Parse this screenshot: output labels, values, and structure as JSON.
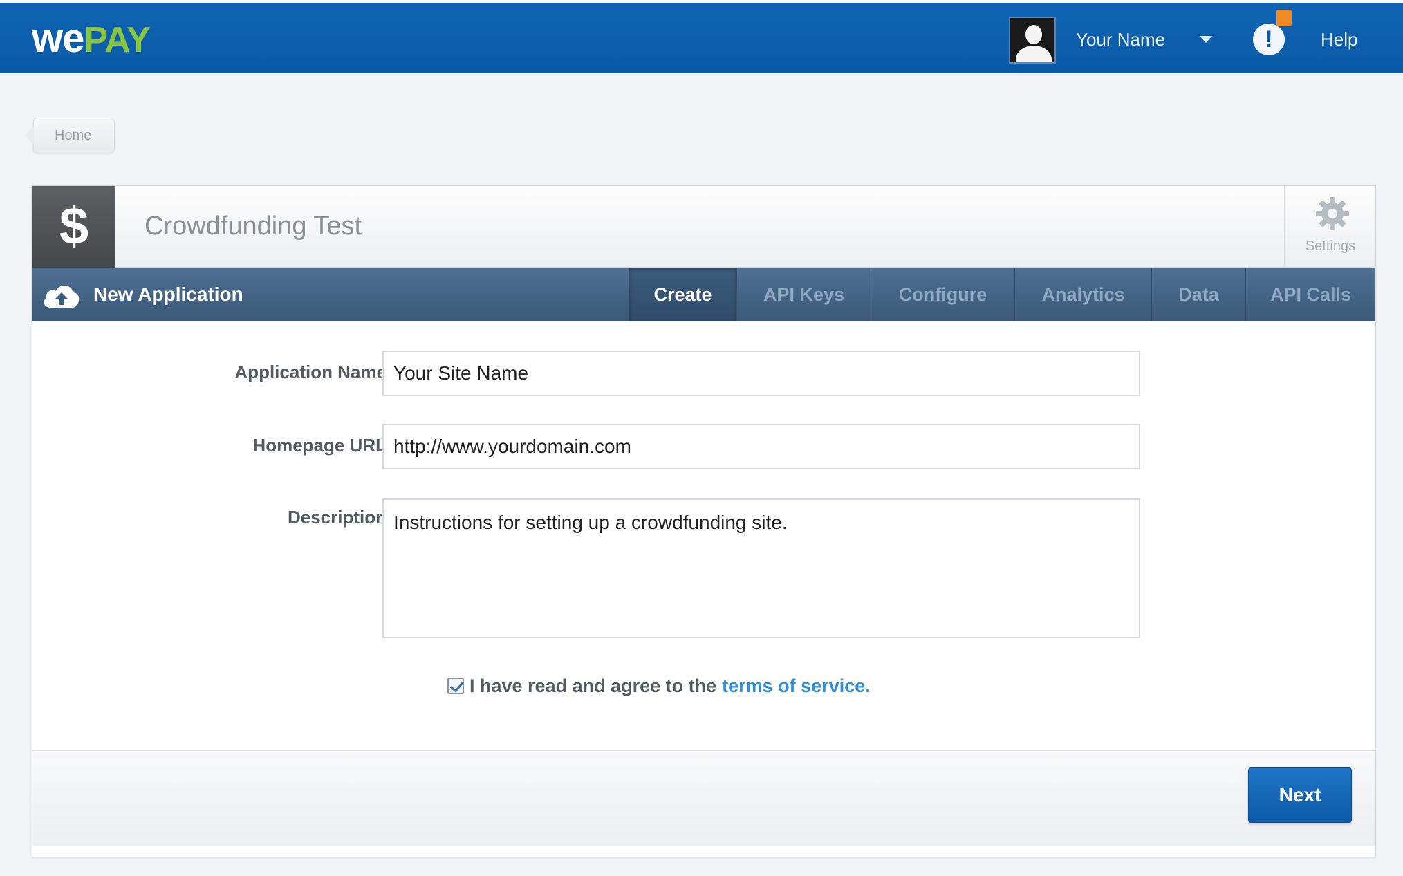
{
  "header": {
    "logo_we": "we",
    "logo_pay": "PAY",
    "user_name": "Your Name",
    "alert_glyph": "!",
    "help_label": "Help"
  },
  "breadcrumb": {
    "home_label": "Home"
  },
  "app": {
    "icon_glyph": "$",
    "title": "Crowdfunding Test",
    "settings_label": "Settings"
  },
  "nav": {
    "title": "New Application",
    "tabs": [
      {
        "label": "Create",
        "active": true
      },
      {
        "label": "API Keys",
        "active": false
      },
      {
        "label": "Configure",
        "active": false
      },
      {
        "label": "Analytics",
        "active": false
      },
      {
        "label": "Data",
        "active": false
      },
      {
        "label": "API Calls",
        "active": false
      }
    ]
  },
  "form": {
    "app_name_label": "Application Name",
    "app_name_value": "Your Site Name",
    "homepage_label": "Homepage URL",
    "homepage_value": "http://www.yourdomain.com",
    "description_label": "Description",
    "description_value": "Instructions for setting up a crowdfunding site.",
    "tos_checked": true,
    "tos_text": "I have read and agree to the",
    "tos_link": "terms of service",
    "tos_period": "."
  },
  "footer": {
    "next_label": "Next"
  },
  "colors": {
    "brand_blue": "#0f64b3",
    "brand_green": "#8cc63f",
    "nav_bg": "#3b5978",
    "link_blue": "#2f8fd6",
    "badge_orange": "#f08a24"
  },
  "icons": [
    "avatar-icon",
    "chevron-down-icon",
    "alert-icon",
    "dollar-icon",
    "gear-icon",
    "cloud-upload-icon",
    "checkbox-checked-icon"
  ]
}
